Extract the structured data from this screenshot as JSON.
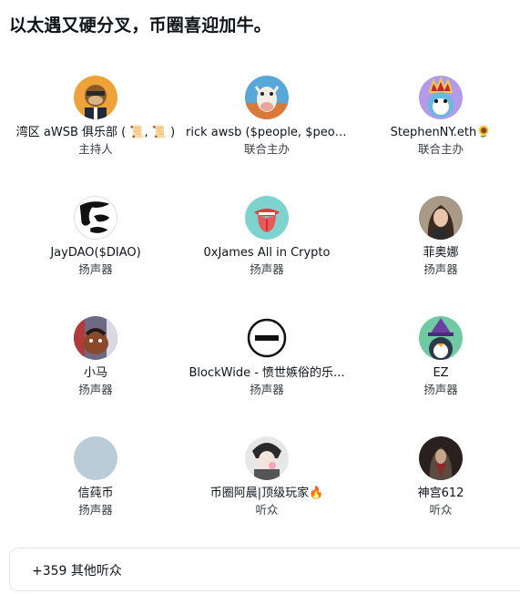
{
  "space": {
    "title": "以太遇又硬分叉，币圈喜迎加牛。"
  },
  "participants": [
    {
      "name": "湾区 aWSB 俱乐部 ( 📜, 📜 )",
      "role": "主持人",
      "avatar": "ape-avatar-icon",
      "color": "#f0a23a"
    },
    {
      "name": "rick awsb ($people, $peop...",
      "role": "联合主办",
      "avatar": "cow-avatar-icon",
      "color": "#57a7d8"
    },
    {
      "name": "StephenNY.eth🌻",
      "role": "联合主办",
      "avatar": "crowned-penguin-avatar-icon",
      "color": "#b49be8"
    },
    {
      "name": "JayDAO($DIAO)",
      "role": "扬声器",
      "avatar": "ink-face-avatar-icon",
      "color": "#ffffff"
    },
    {
      "name": "0xJames All in Crypto",
      "role": "扬声器",
      "avatar": "tongue-avatar-icon",
      "color": "#7fd3cf"
    },
    {
      "name": "菲奥娜",
      "role": "扬声器",
      "avatar": "woman-photo-avatar-icon",
      "color": "#5d5348"
    },
    {
      "name": "小马",
      "role": "扬声器",
      "avatar": "pony-avatar-icon",
      "color": "#6e6a86"
    },
    {
      "name": "BlockWide - 愤世嫉俗的乐...",
      "role": "扬声器",
      "avatar": "blockwide-logo-avatar-icon",
      "color": "#ffffff"
    },
    {
      "name": "EZ",
      "role": "扬声器",
      "avatar": "wizard-penguin-avatar-icon",
      "color": "#71c9a3"
    },
    {
      "name": "信莼币",
      "role": "扬声器",
      "avatar": "default-avatar-icon",
      "color": "#b9ccd8"
    },
    {
      "name": "币圈阿晨|顶级玩家🔥",
      "role": "听众",
      "avatar": "anime-avatar-icon",
      "color": "#e7e7e7"
    },
    {
      "name": "神宫612",
      "role": "听众",
      "avatar": "dark-figure-avatar-icon",
      "color": "#2b2020"
    }
  ],
  "listeners": {
    "label": "+359 其他听众"
  }
}
